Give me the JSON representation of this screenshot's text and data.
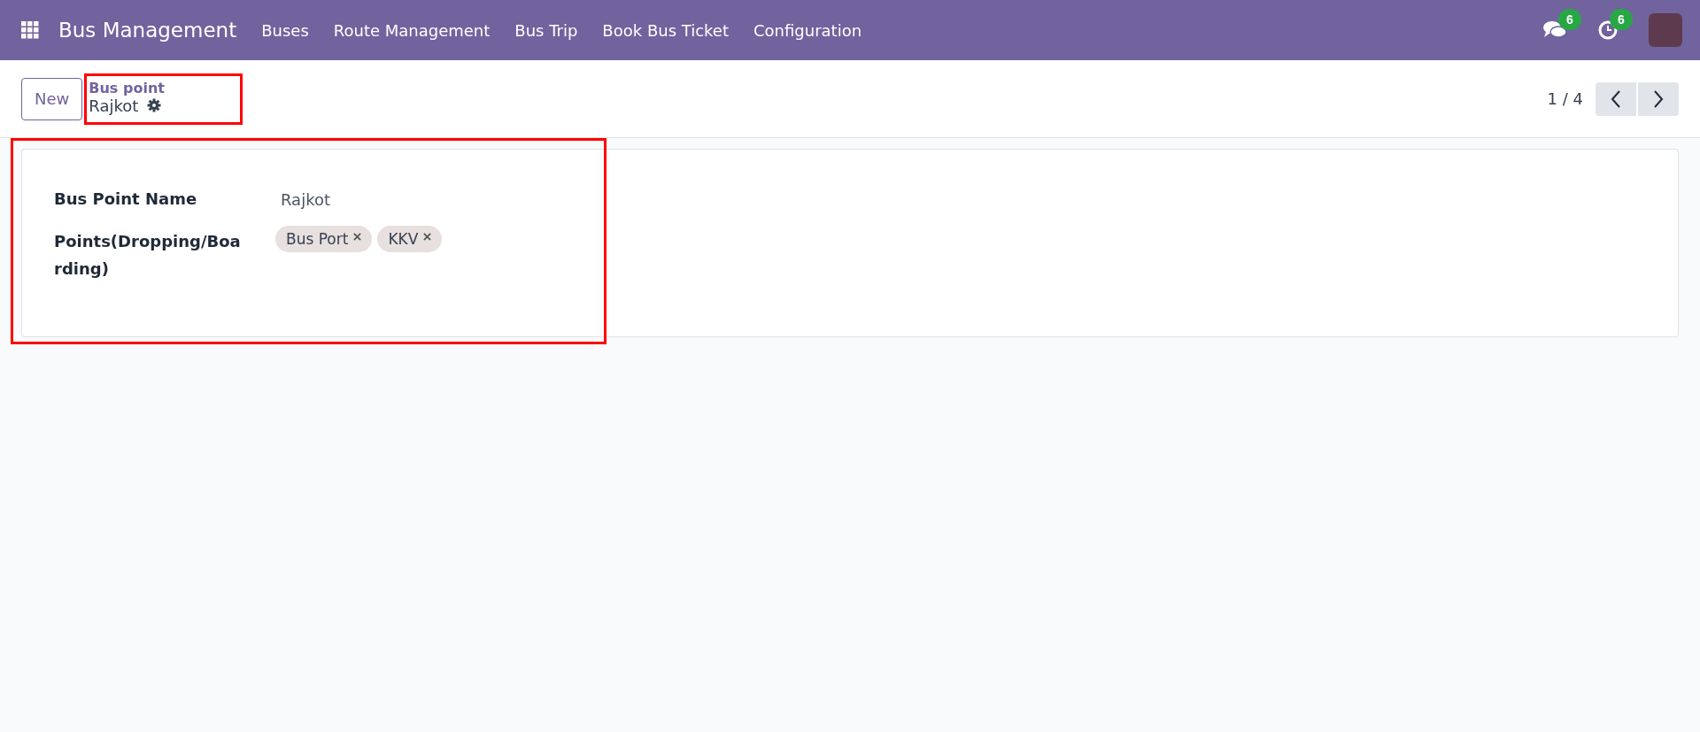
{
  "navbar": {
    "app_name": "Bus Management",
    "menu": [
      "Buses",
      "Route Management",
      "Bus Trip",
      "Book Bus Ticket",
      "Configuration"
    ],
    "messages_count": "6",
    "activities_count": "6"
  },
  "control_panel": {
    "new_button": "New",
    "breadcrumb": "Bus point",
    "record_title": "Rajkot",
    "pager": "1 / 4"
  },
  "form": {
    "fields": [
      {
        "kind": "text",
        "label": "Bus Point Name",
        "value": "Rajkot"
      },
      {
        "kind": "tags",
        "label": "Points(Dropping/Boarding)",
        "tags": [
          "Bus Port",
          "KKV"
        ]
      }
    ]
  }
}
